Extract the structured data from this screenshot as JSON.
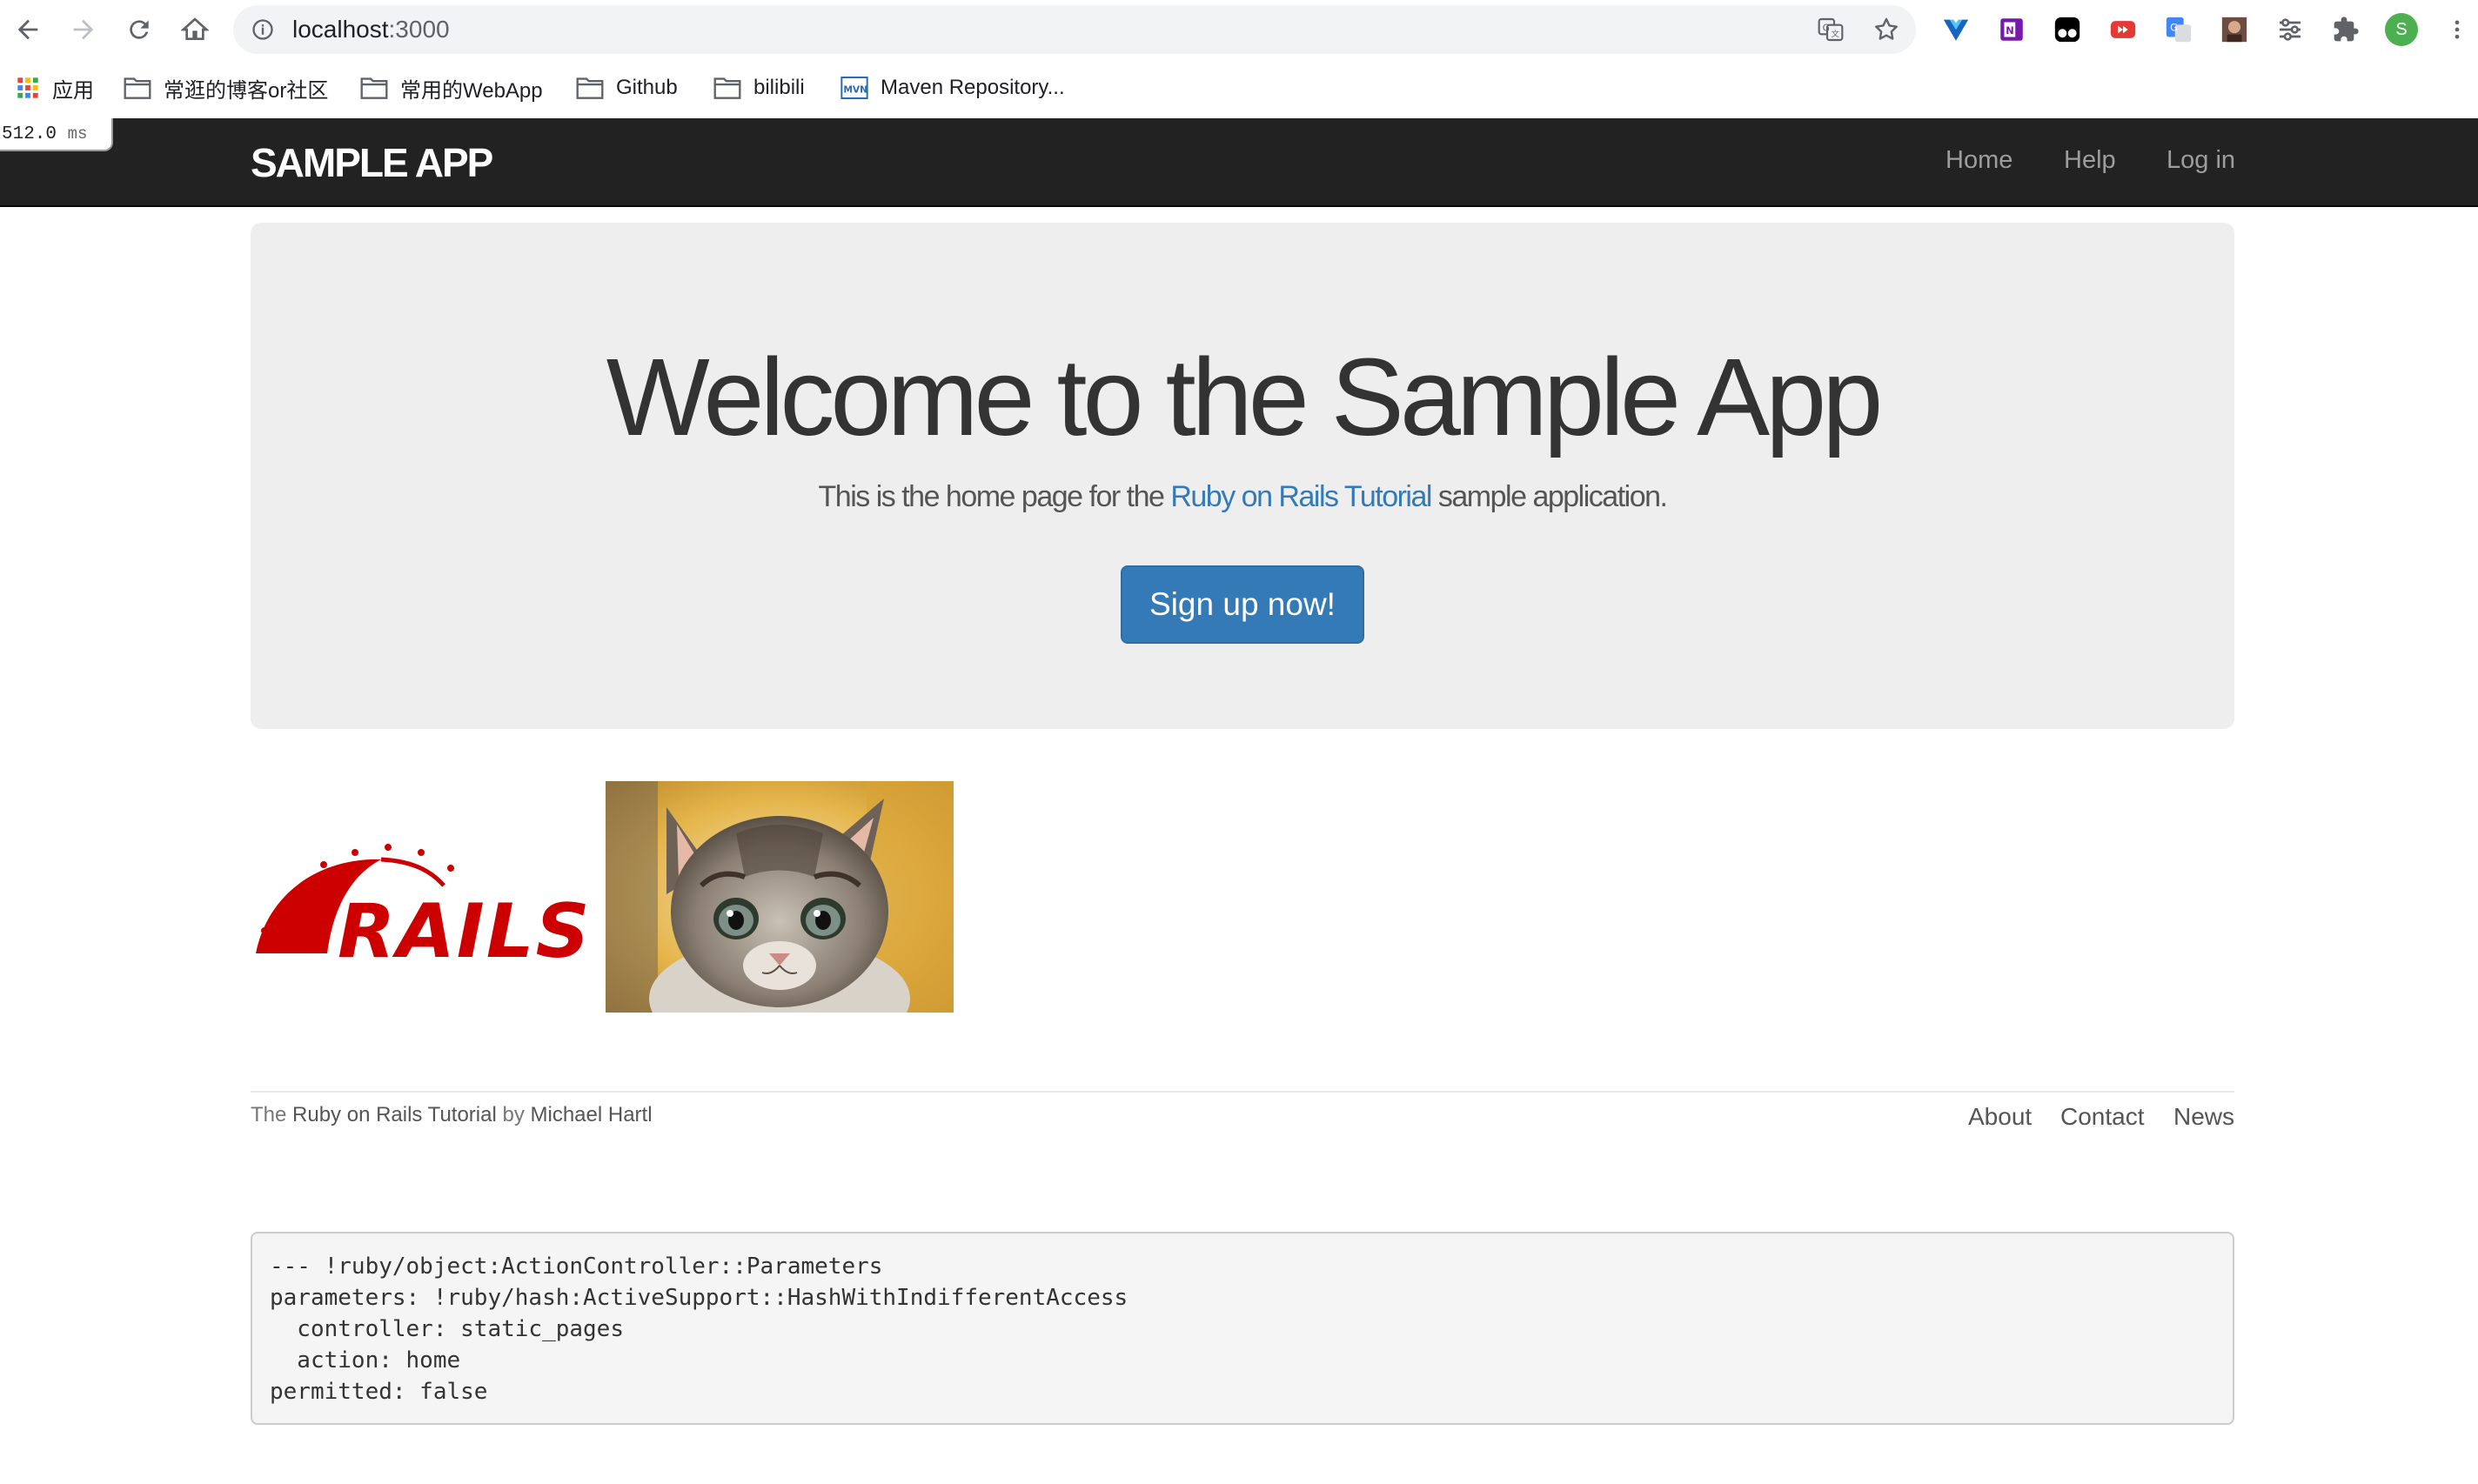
{
  "browser": {
    "url_host": "localhost",
    "url_port": ":3000",
    "bookmarks": [
      "应用",
      "常逛的博客or社区",
      "常用的WebApp",
      "Github",
      "bilibili",
      "Maven Repository..."
    ],
    "profile_initial": "S"
  },
  "timer": {
    "value": "512.0",
    "unit": "ms"
  },
  "header": {
    "logo": "SAMPLE APP",
    "nav": [
      "Home",
      "Help",
      "Log in"
    ]
  },
  "hero": {
    "title": "Welcome to the Sample App",
    "sub_before": "This is the home page for the ",
    "sub_link": "Ruby on Rails Tutorial",
    "sub_after": " sample application.",
    "button": "Sign up now!"
  },
  "images": {
    "rails_text": "RAILS"
  },
  "footer": {
    "the": "The ",
    "tutorial_link": "Ruby on Rails Tutorial",
    "by": " by ",
    "author_link": "Michael Hartl",
    "links": [
      "About",
      "Contact",
      "News"
    ]
  },
  "debug": {
    "lines": [
      "--- !ruby/object:ActionController::Parameters",
      "parameters: !ruby/hash:ActiveSupport::HashWithIndifferentAccess",
      "  controller: static_pages",
      "  action: home",
      "permitted: false"
    ]
  },
  "colors": {
    "navbar": "#222222",
    "jumbotron": "#eeeeee",
    "primary": "#337ab7",
    "rails_red": "#cc0000"
  }
}
